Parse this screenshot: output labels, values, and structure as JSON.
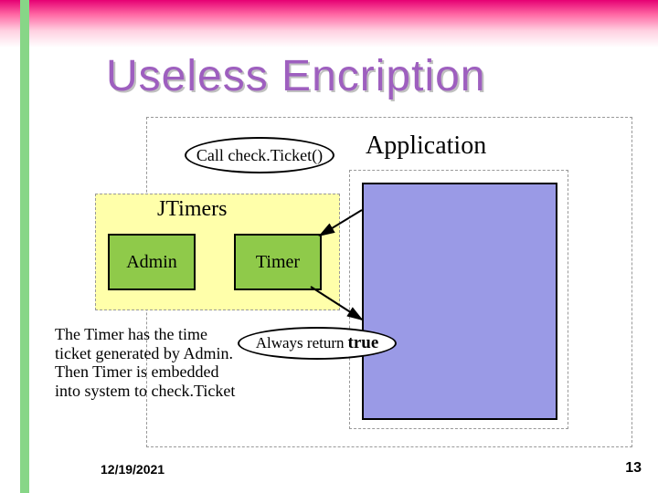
{
  "title": "Useless Encription",
  "application_label": "Application",
  "call_label": "Call check.Ticket()",
  "jtimers_label": "JTimers",
  "admin_label": "Admin",
  "timer_label": "Timer",
  "note_text": "The Timer has the time ticket generated by Admin. Then Timer is embedded into system to check.Ticket",
  "return_prefix": "Always return",
  "return_value": "true",
  "footer": {
    "date": "12/19/2021",
    "page": "13"
  }
}
